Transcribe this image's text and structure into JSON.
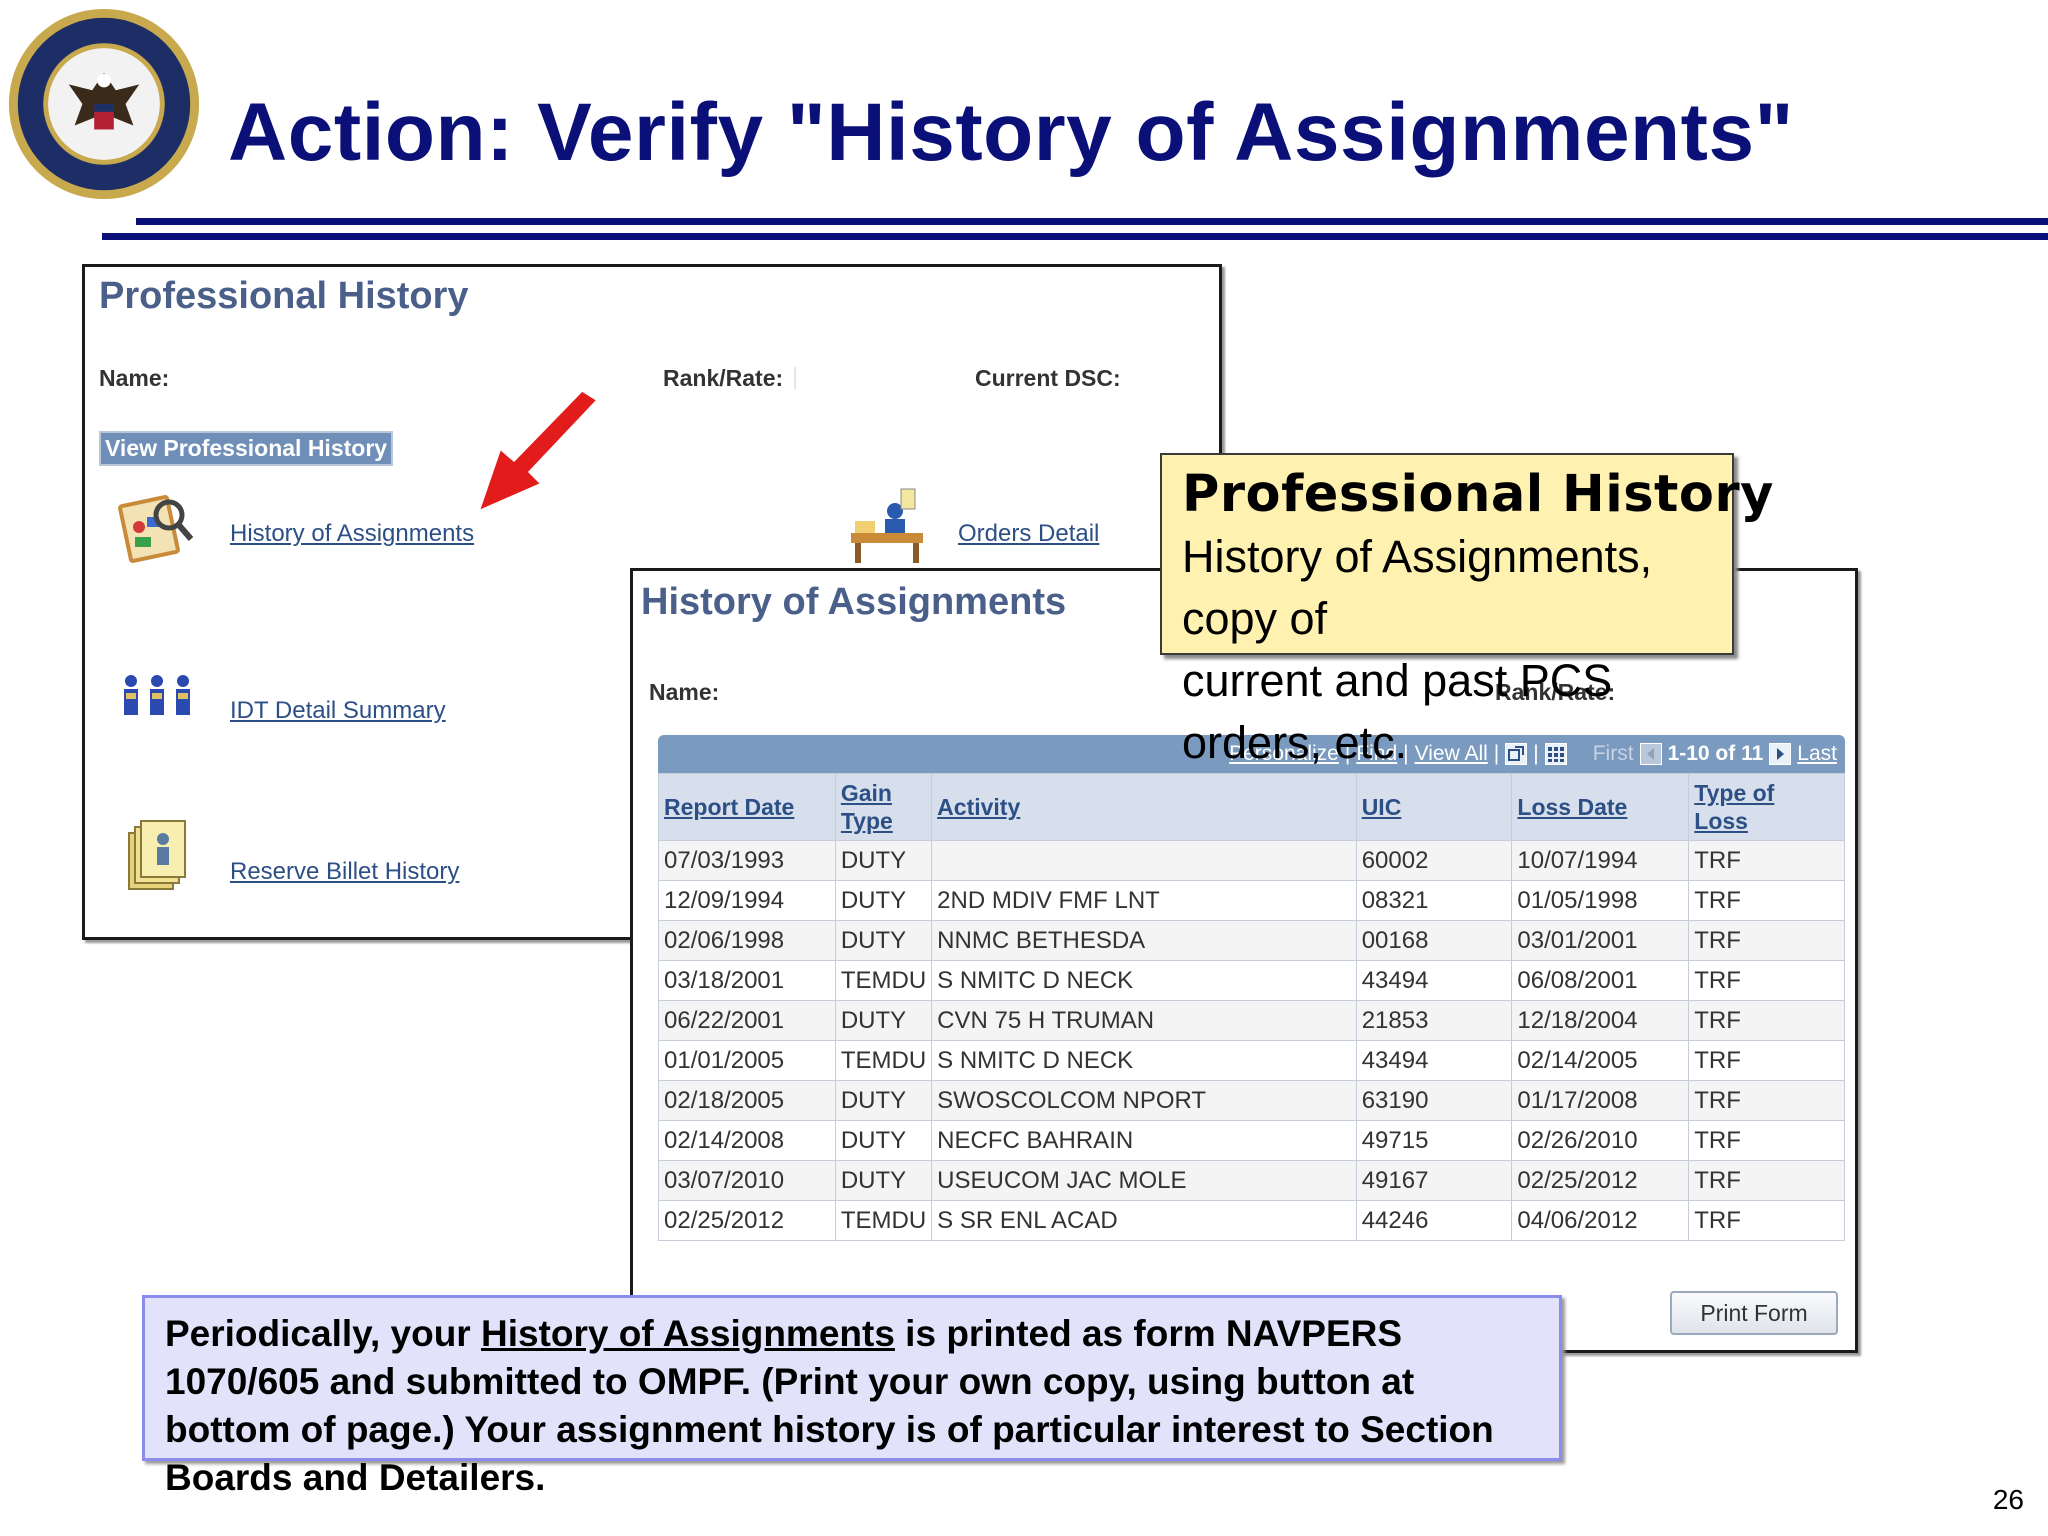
{
  "slide": {
    "title": "Action: Verify \"History of Assignments\"",
    "page_number": "26"
  },
  "professional_history": {
    "title": "Professional History",
    "name_label": "Name:",
    "rank_label": "Rank/Rate:",
    "dsc_label": "Current DSC:",
    "section_button": "View Professional History",
    "links": {
      "history": "History of Assignments",
      "orders": "Orders Detail",
      "idt": "IDT Detail Summary",
      "reserve": "Reserve Billet History"
    }
  },
  "history_of_assignments": {
    "title": "History of Assignments",
    "name_label": "Name:",
    "rank_label": "Rank/Rate:",
    "nav": {
      "personalize": "Personalize",
      "find": "Find",
      "view_all": "View All",
      "sep": "|",
      "first": "First",
      "range": "1-10 of 11",
      "last": "Last"
    },
    "columns": {
      "report_date": "Report Date",
      "gain_type_1": "Gain",
      "gain_type_2": "Type",
      "activity": "Activity",
      "uic": "UIC",
      "loss_date": "Loss Date",
      "type_of_loss_1": "Type of",
      "type_of_loss_2": "Loss"
    },
    "rows": [
      {
        "report_date": "07/03/1993",
        "gain_type": "DUTY",
        "activity": "",
        "uic": "60002",
        "loss_date": "10/07/1994",
        "type_of_loss": "TRF"
      },
      {
        "report_date": "12/09/1994",
        "gain_type": "DUTY",
        "activity": "2ND MDIV FMF LNT",
        "uic": "08321",
        "loss_date": "01/05/1998",
        "type_of_loss": "TRF"
      },
      {
        "report_date": "02/06/1998",
        "gain_type": "DUTY",
        "activity": "NNMC BETHESDA",
        "uic": "00168",
        "loss_date": "03/01/2001",
        "type_of_loss": "TRF"
      },
      {
        "report_date": "03/18/2001",
        "gain_type": "TEMDU",
        "activity": "S NMITC D NECK",
        "uic": "43494",
        "loss_date": "06/08/2001",
        "type_of_loss": "TRF"
      },
      {
        "report_date": "06/22/2001",
        "gain_type": "DUTY",
        "activity": "CVN 75 H TRUMAN",
        "uic": "21853",
        "loss_date": "12/18/2004",
        "type_of_loss": "TRF"
      },
      {
        "report_date": "01/01/2005",
        "gain_type": "TEMDU",
        "activity": "S NMITC D NECK",
        "uic": "43494",
        "loss_date": "02/14/2005",
        "type_of_loss": "TRF"
      },
      {
        "report_date": "02/18/2005",
        "gain_type": "DUTY",
        "activity": "SWOSCOLCOM NPORT",
        "uic": "63190",
        "loss_date": "01/17/2008",
        "type_of_loss": "TRF"
      },
      {
        "report_date": "02/14/2008",
        "gain_type": "DUTY",
        "activity": "NECFC BAHRAIN",
        "uic": "49715",
        "loss_date": "02/26/2010",
        "type_of_loss": "TRF"
      },
      {
        "report_date": "03/07/2010",
        "gain_type": "DUTY",
        "activity": "USEUCOM JAC MOLE",
        "uic": "49167",
        "loss_date": "02/25/2012",
        "type_of_loss": "TRF"
      },
      {
        "report_date": "02/25/2012",
        "gain_type": "TEMDU",
        "activity": "S SR ENL ACAD",
        "uic": "44246",
        "loss_date": "04/06/2012",
        "type_of_loss": "TRF"
      }
    ],
    "print_button": "Print Form"
  },
  "callout": {
    "title": "Professional History",
    "line1": "History of Assignments, copy of",
    "line2": "current and past PCS orders, etc."
  },
  "note": {
    "part1": "Periodically, your ",
    "link": "History of Assignments",
    "part2": " is printed as form NAVPERS 1070/605 and submitted to OMPF. (Print your own copy, using button at bottom of page.) Your assignment history is of particular interest to Section Boards and Detailers."
  },
  "icons": [
    "navy-seal-icon",
    "history-of-assignments-icon",
    "orders-detail-icon",
    "idt-detail-icon",
    "reserve-billet-icon",
    "red-arrow-icon",
    "new-window-icon",
    "download-grid-icon",
    "first-arrow-icon",
    "next-arrow-icon"
  ],
  "colors": {
    "title_navy": "#0a1078",
    "panel_title": "#4a5f8a",
    "link_blue": "#2c4f86",
    "grid_header": "#7b9ac0",
    "callout_bg": "#fff2b0",
    "note_bg": "#e2e2fb",
    "arrow_red": "#e21b1b"
  }
}
